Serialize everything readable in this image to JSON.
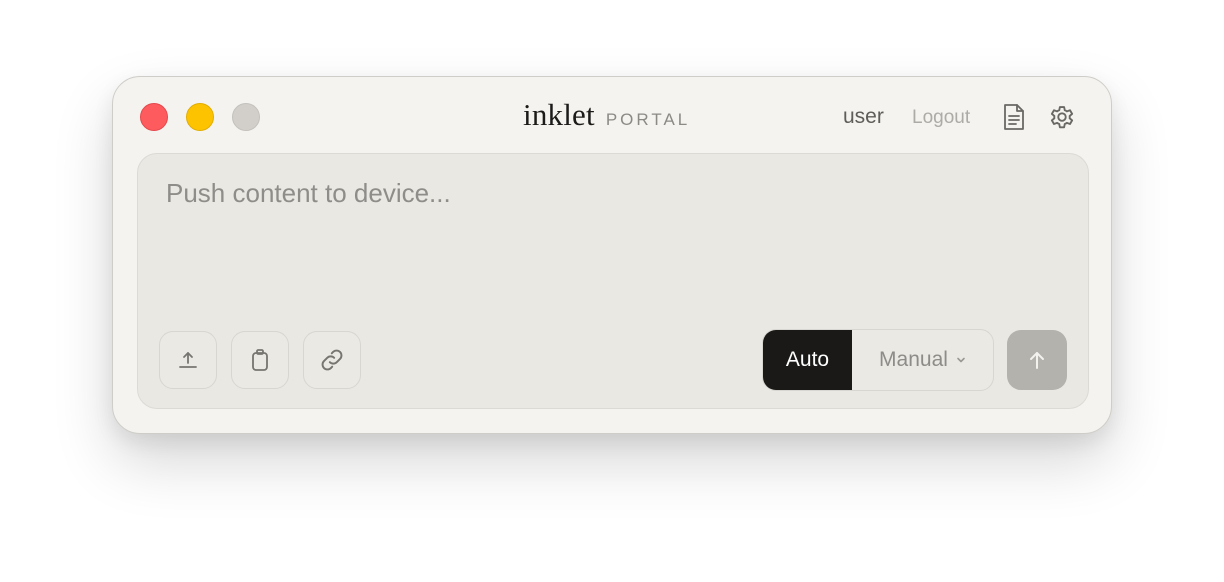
{
  "window": {
    "controls": [
      "close",
      "minimize",
      "zoom"
    ],
    "colors": {
      "close": "#fd5b5e",
      "minimize": "#fdc300",
      "zoom": "#d2cfca"
    }
  },
  "header": {
    "brand_name": "inklet",
    "brand_sub": "PORTAL",
    "user": "user",
    "logout": "Logout",
    "icons": [
      "document-icon",
      "gear-icon"
    ]
  },
  "composer": {
    "placeholder": "Push content to device...",
    "value": "",
    "tools": [
      "upload-icon",
      "clipboard-icon",
      "link-icon"
    ],
    "mode": {
      "options": [
        "Auto",
        "Manual"
      ],
      "selected": "Auto"
    },
    "send_icon": "arrow-up-icon",
    "accent": "#1a1918"
  }
}
